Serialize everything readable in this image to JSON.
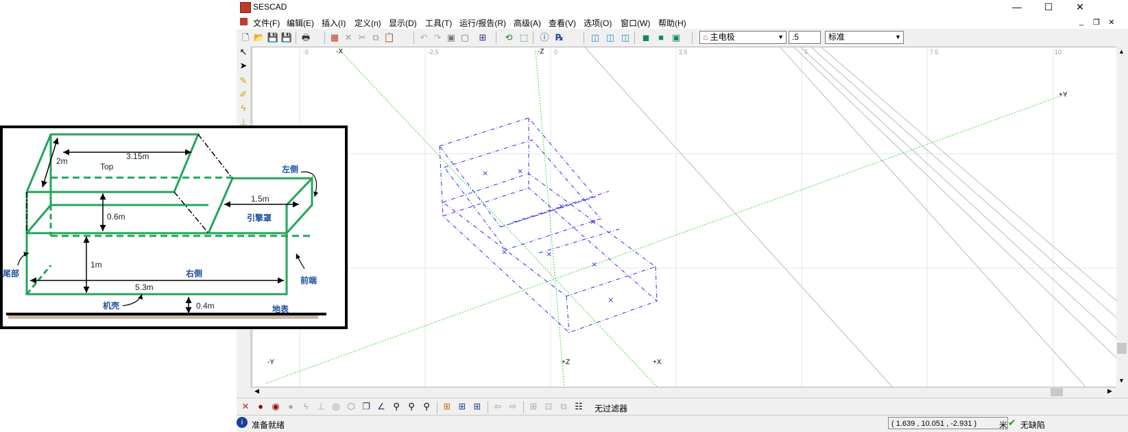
{
  "window": {
    "title": "SESCAD",
    "controls": {
      "minimize": "—",
      "maximize": "☐",
      "close": "✕"
    },
    "mdi_controls": {
      "minimize": "_",
      "restore": "❐",
      "close": "✕"
    }
  },
  "menu": [
    "文件(F)",
    "编辑(E)",
    "插入(I)",
    "定义(n)",
    "显示(D)",
    "工具(T)",
    "运行/报告(R)",
    "高级(A)",
    "查看(V)",
    "选项(O)",
    "窗口(W)",
    "帮助(H)"
  ],
  "toolbar": {
    "electrode_select": "主电极",
    "value_input": ".5",
    "style_select": "标准"
  },
  "viewport": {
    "x_ticks": [
      "-5",
      "-2.5",
      "0",
      "2.5",
      "5",
      "7.5",
      "10"
    ],
    "axis_labels": {
      "neg_x": "-X",
      "neg_z": "-Z",
      "pos_y": "+Y",
      "neg_y": "-Y",
      "pos_z": "+Z",
      "pos_x": "+X"
    }
  },
  "bottom_toolbar": {
    "filter_label": "无过滤器"
  },
  "status": {
    "message": "准备就绪",
    "coord_x": "1.639",
    "coord_y": "10.051",
    "coord_z": "-2.931",
    "unit": "米",
    "defect_status": "无缺陷"
  },
  "inset_diagram": {
    "top": "Top",
    "dim_width": "3.15m",
    "dim_depth": "2m",
    "dim_height_upper": "0.6m",
    "dim_height_lower": "1m",
    "dim_hood": "1.5m",
    "dim_length": "5.3m",
    "dim_ground": "0.4m",
    "left_side": "左侧",
    "hood": "引擎罩",
    "rear": "尾部",
    "right_side": "右侧",
    "front": "前端",
    "chassis": "机壳",
    "ground": "地表"
  },
  "colors": {
    "green_wire": "#22a55a",
    "blue_wire": "#2d2de0",
    "axis_green": "#3dd63d"
  }
}
